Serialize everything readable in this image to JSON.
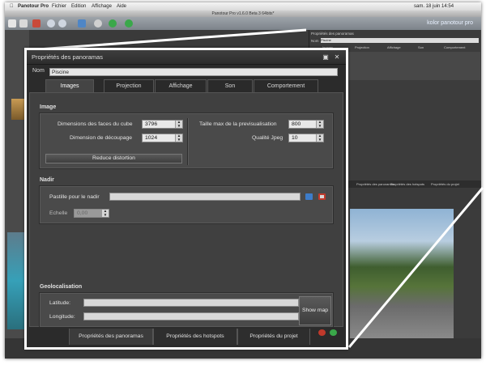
{
  "background": {
    "menubar": {
      "apple": "",
      "app": "Panotour Pro",
      "items": [
        "Fichier",
        "Edition",
        "Affichage",
        "Aide"
      ],
      "clock": "sam. 18 juin  14:54"
    },
    "window_title": "Panotour Pro v1.6.0 Beta 3 64bits*",
    "brand": "kolor panotour pro",
    "mini_panel": {
      "title": "Propriétés des panoramas",
      "nom_label": "Nom",
      "nom_value": "Piscine",
      "tabs": [
        "Images",
        "Projection",
        "Affichage",
        "Son",
        "Comportement"
      ],
      "bottom_tabs": [
        "Propriétés des panoramas",
        "Propriétés des hotspots",
        "Propriétés du projet"
      ]
    }
  },
  "panel": {
    "title": "Propriétés des panoramas",
    "nom_label": "Nom",
    "nom_value": "Piscine",
    "tabs": [
      {
        "label": "Images",
        "active": true
      },
      {
        "label": "Projection",
        "active": false
      },
      {
        "label": "Affichage",
        "active": false
      },
      {
        "label": "Son",
        "active": false
      },
      {
        "label": "Comportement",
        "active": false
      }
    ],
    "image_section": {
      "title": "Image",
      "cube_faces_label": "Dimensions des faces du cube",
      "cube_faces_value": "3796",
      "crop_label": "Dimension de découpage",
      "crop_value": "1024",
      "reduce_button": "Reduce distortion",
      "preview_max_label": "Taille max de la previsualisation",
      "preview_max_value": "800",
      "jpeg_quality_label": "Qualité Jpeg",
      "jpeg_quality_value": "10"
    },
    "nadir_section": {
      "title": "Nadir",
      "patch_label": "Pastille pour le nadir",
      "patch_value": "",
      "scale_label": "Echelle",
      "scale_value": "0,00"
    },
    "geo_section": {
      "title": "Geolocalisation",
      "latitude_label": "Latitude:",
      "latitude_value": "",
      "longitude_label": "Longitude:",
      "longitude_value": "",
      "show_map_button": "Show map"
    },
    "bottom_tabs": [
      {
        "label": "Propriétés des panoramas",
        "active": true
      },
      {
        "label": "Propriétés des hotspots",
        "active": false
      },
      {
        "label": "Propriétés du projet",
        "active": false
      }
    ]
  },
  "colors": {
    "panel_bg": "#2b2b2b",
    "section_bg": "#404040",
    "box_bg": "#4a4a4a",
    "accent_blue": "#3d7cc9",
    "accent_red": "#c0392b",
    "accent_green": "#3aa84a"
  },
  "icons": [
    "apple-icon",
    "new-icon",
    "open-icon",
    "delete-icon",
    "undo-icon",
    "redo-icon",
    "preview-icon",
    "settings-icon",
    "play-icon",
    "help-icon",
    "browse-icon",
    "clear-icon",
    "hotspot-add-icon",
    "hotspot-link-icon"
  ]
}
